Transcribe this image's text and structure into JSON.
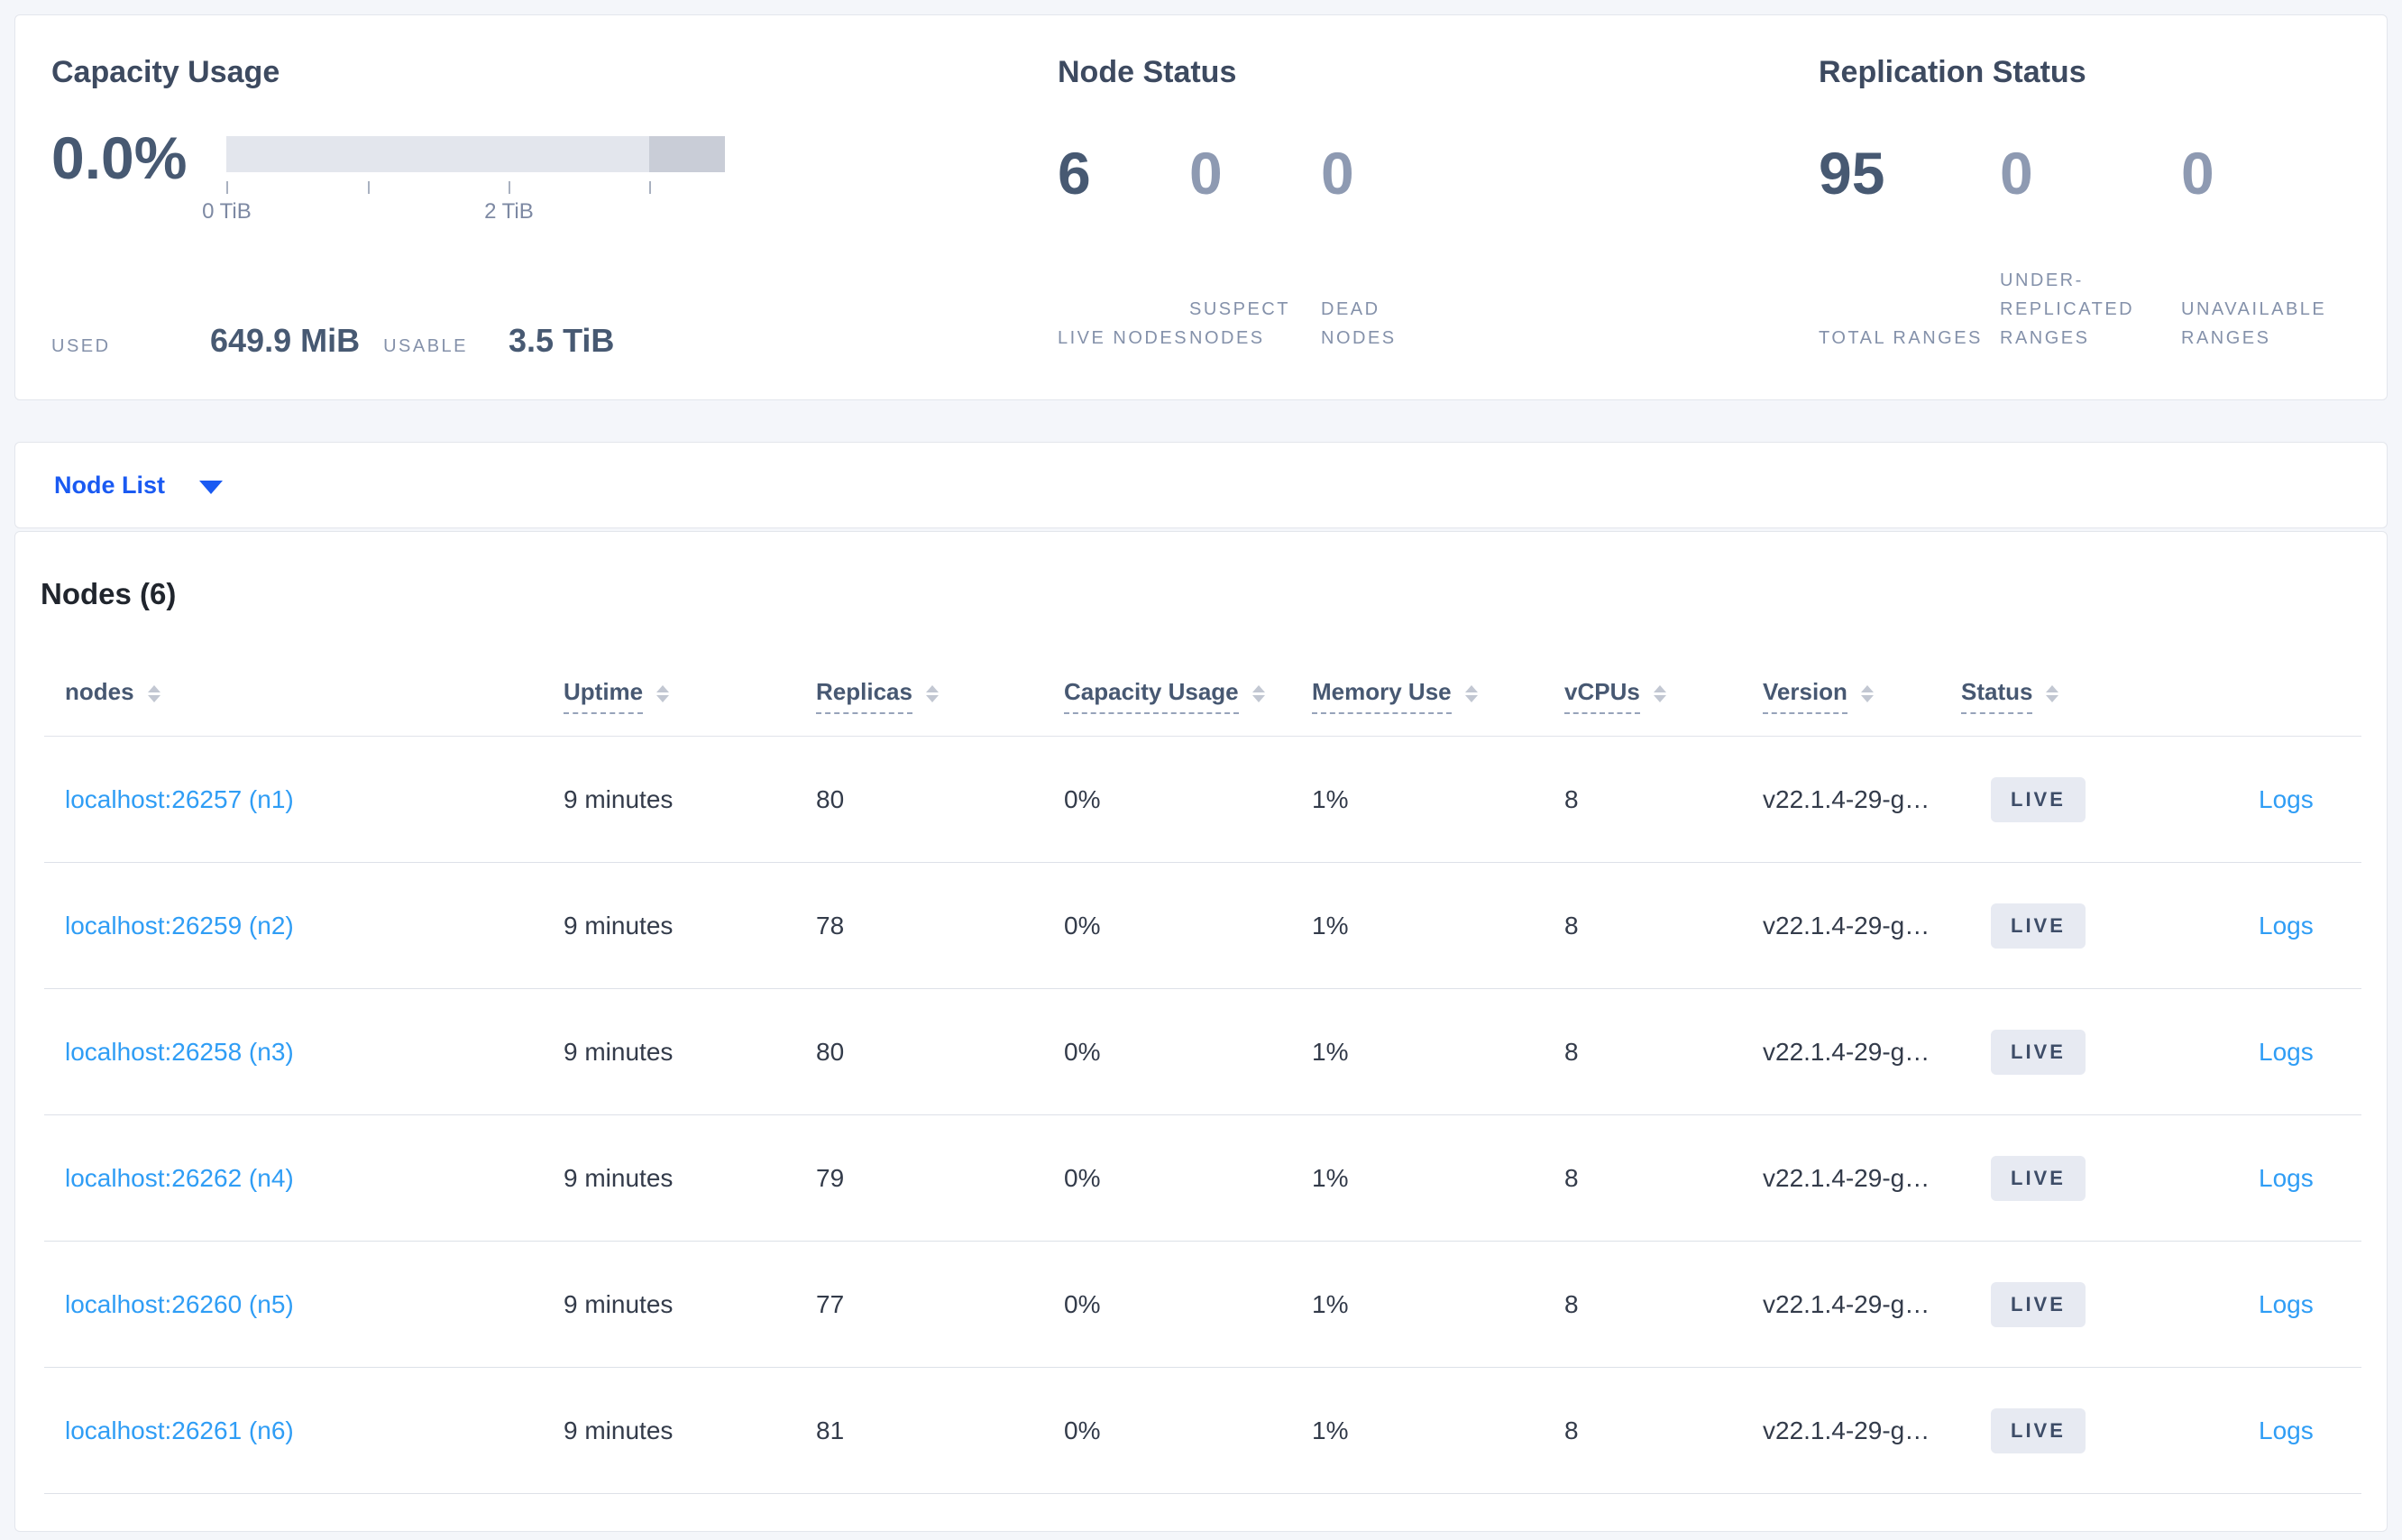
{
  "overview": {
    "capacity": {
      "title": "Capacity Usage",
      "percent": "0.0%",
      "bar": {
        "usable_fraction": 0.848,
        "ticks": [
          {
            "pos": 0,
            "label": "0 TiB"
          },
          {
            "pos": 0.283
          },
          {
            "pos": 0.566,
            "label": "2 TiB"
          },
          {
            "pos": 0.848
          }
        ]
      },
      "used_label": "USED",
      "used_value": "649.9 MiB",
      "usable_label": "USABLE",
      "usable_value": "3.5 TiB"
    },
    "node_status": {
      "title": "Node Status",
      "stats": [
        {
          "value": "6",
          "label": "LIVE NODES",
          "dim": false
        },
        {
          "value": "0",
          "label": "SUSPECT NODES",
          "dim": true
        },
        {
          "value": "0",
          "label": "DEAD NODES",
          "dim": true
        }
      ]
    },
    "replication_status": {
      "title": "Replication Status",
      "stats": [
        {
          "value": "95",
          "label": "TOTAL RANGES",
          "dim": false
        },
        {
          "value": "0",
          "label": "UNDER-REPLICATED RANGES",
          "dim": true
        },
        {
          "value": "0",
          "label": "UNAVAILABLE RANGES",
          "dim": true
        }
      ]
    }
  },
  "view_selector": {
    "label": "Node List"
  },
  "nodes_table": {
    "title": "Nodes (6)",
    "columns": [
      {
        "key": "nodes",
        "label": "nodes",
        "underline": false
      },
      {
        "key": "uptime",
        "label": "Uptime",
        "underline": true
      },
      {
        "key": "replicas",
        "label": "Replicas",
        "underline": true
      },
      {
        "key": "capacity-usage",
        "label": "Capacity Usage",
        "underline": true
      },
      {
        "key": "memory-use",
        "label": "Memory Use",
        "underline": true
      },
      {
        "key": "vcpus",
        "label": "vCPUs",
        "underline": true
      },
      {
        "key": "version",
        "label": "Version",
        "underline": true
      },
      {
        "key": "status",
        "label": "Status",
        "underline": true
      }
    ],
    "rows": [
      {
        "node": "localhost:26257 (n1)",
        "uptime": "9 minutes",
        "replicas": "80",
        "capacity": "0%",
        "memory": "1%",
        "vcpus": "8",
        "version": "v22.1.4-29-g…",
        "status": "LIVE",
        "logs": "Logs"
      },
      {
        "node": "localhost:26259 (n2)",
        "uptime": "9 minutes",
        "replicas": "78",
        "capacity": "0%",
        "memory": "1%",
        "vcpus": "8",
        "version": "v22.1.4-29-g…",
        "status": "LIVE",
        "logs": "Logs"
      },
      {
        "node": "localhost:26258 (n3)",
        "uptime": "9 minutes",
        "replicas": "80",
        "capacity": "0%",
        "memory": "1%",
        "vcpus": "8",
        "version": "v22.1.4-29-g…",
        "status": "LIVE",
        "logs": "Logs"
      },
      {
        "node": "localhost:26262 (n4)",
        "uptime": "9 minutes",
        "replicas": "79",
        "capacity": "0%",
        "memory": "1%",
        "vcpus": "8",
        "version": "v22.1.4-29-g…",
        "status": "LIVE",
        "logs": "Logs"
      },
      {
        "node": "localhost:26260 (n5)",
        "uptime": "9 minutes",
        "replicas": "77",
        "capacity": "0%",
        "memory": "1%",
        "vcpus": "8",
        "version": "v22.1.4-29-g…",
        "status": "LIVE",
        "logs": "Logs"
      },
      {
        "node": "localhost:26261 (n6)",
        "uptime": "9 minutes",
        "replicas": "81",
        "capacity": "0%",
        "memory": "1%",
        "vcpus": "8",
        "version": "v22.1.4-29-g…",
        "status": "LIVE",
        "logs": "Logs"
      }
    ]
  }
}
